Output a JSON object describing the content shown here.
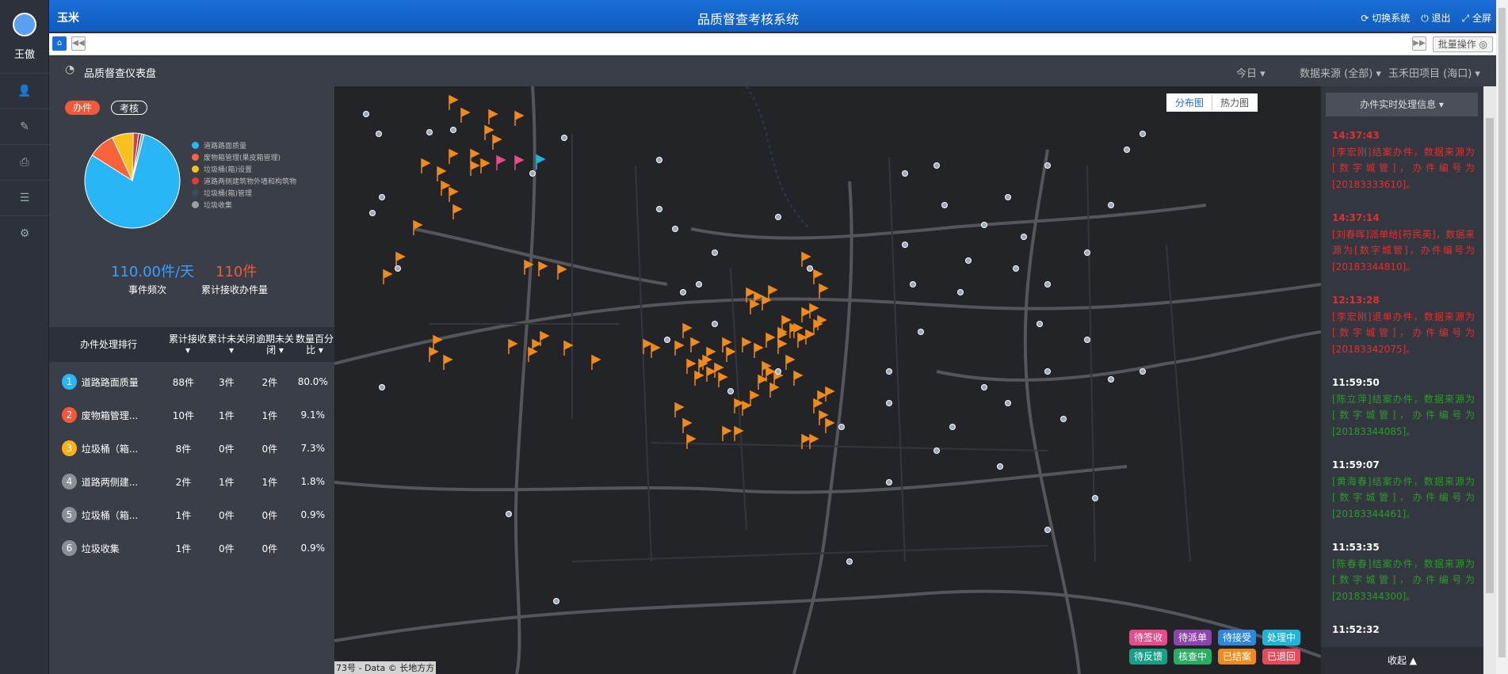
{
  "app": {
    "logo": "玉米",
    "title": "品质督查考核系统",
    "switch_label": "切换系统",
    "logout_label": "退出",
    "fullscreen_label": "全屏"
  },
  "tabbar": {
    "batch_label": "批量操作"
  },
  "user": {
    "name": "王傲"
  },
  "dashboard": {
    "title": "品质督查仪表盘",
    "filters": {
      "date": "今日",
      "source": "数据来源 (全部)",
      "project": "玉禾田项目 (海口)"
    }
  },
  "left": {
    "pills": [
      "办件",
      "考核"
    ],
    "pie_legend": [
      {
        "label": "道路路面质量",
        "color": "#29b6f6"
      },
      {
        "label": "废物箱管理(果皮箱管理)",
        "color": "#f7643c"
      },
      {
        "label": "垃圾桶(箱)设置",
        "color": "#f9c11d"
      },
      {
        "label": "道路两侧建筑物外墙和构筑物",
        "color": "#e53935"
      },
      {
        "label": "垃圾桶(箱)管理",
        "color": "#3f4a5c"
      },
      {
        "label": "垃圾收集",
        "color": "#9aa0a6"
      }
    ],
    "stat1_value": "110.00件/天",
    "stat1_label": "事件频次",
    "stat2_value": "110件",
    "stat2_label": "累计接收办件量",
    "rank_headers": [
      "办件处理排行",
      "累计接收",
      "累计未关闭",
      "逾期未关闭",
      "数量百分比"
    ],
    "rank_rows": [
      {
        "n": "1",
        "name": "道路路面质量",
        "recv": "88件",
        "open": "3件",
        "overdue": "2件",
        "pct": "80.0%",
        "color": "#29b6f6"
      },
      {
        "n": "2",
        "name": "废物箱管理...",
        "recv": "10件",
        "open": "1件",
        "overdue": "1件",
        "pct": "9.1%",
        "color": "#f05a3a"
      },
      {
        "n": "3",
        "name": "垃圾桶（箱...",
        "recv": "8件",
        "open": "0件",
        "overdue": "0件",
        "pct": "7.3%",
        "color": "#f9b21d"
      },
      {
        "n": "4",
        "name": "道路两侧建...",
        "recv": "2件",
        "open": "1件",
        "overdue": "1件",
        "pct": "1.8%",
        "color": "#8a8f98"
      },
      {
        "n": "5",
        "name": "垃圾桶（箱...",
        "recv": "1件",
        "open": "0件",
        "overdue": "0件",
        "pct": "0.9%",
        "color": "#8a8f98"
      },
      {
        "n": "6",
        "name": "垃圾收集",
        "recv": "1件",
        "open": "0件",
        "overdue": "0件",
        "pct": "0.9%",
        "color": "#8a8f98"
      }
    ]
  },
  "chart_data": {
    "type": "pie",
    "categories": [
      "道路路面质量",
      "废物箱管理",
      "垃圾桶(箱)设置",
      "道路两侧建筑物",
      "垃圾桶(箱)管理",
      "垃圾收集"
    ],
    "values": [
      88,
      10,
      8,
      2,
      1,
      1
    ]
  },
  "map": {
    "tabs": [
      "分布图",
      "热力图"
    ],
    "attribution": "73号 - Data © 长地方方",
    "legend": [
      {
        "label": "待签收",
        "color": "#e84a8a"
      },
      {
        "label": "待派单",
        "color": "#8e44ad"
      },
      {
        "label": "待接受",
        "color": "#2e86de"
      },
      {
        "label": "处理中",
        "color": "#1fb5d6"
      },
      {
        "label": "待反馈",
        "color": "#16a085"
      },
      {
        "label": "核查中",
        "color": "#27ae60"
      },
      {
        "label": "已结案",
        "color": "#f08a1a"
      },
      {
        "label": "已退回",
        "color": "#e84a5a"
      }
    ]
  },
  "right": {
    "head": "办件实时处理信息",
    "collapse": "收起",
    "feed": [
      {
        "time": "14:37:43",
        "time_color": "red",
        "text": "[李宏刚]结案办件，数据来源为[数字城管]，办件编号为[20183333610]。",
        "color": "red"
      },
      {
        "time": "14:37:14",
        "time_color": "red",
        "text": "[刘春晖]派单给[符民英]，数据来源为[数字城管]，办件编号为[20183344810]。",
        "color": "red"
      },
      {
        "time": "12:13:28",
        "time_color": "red",
        "text": "[李宏刚]退单办件，数据来源为[数字城管]，办件编号为[20183342075]。",
        "color": "red"
      },
      {
        "time": "11:59:50",
        "time_color": "white",
        "text": "[陈立萍]结案办件，数据来源为[数字城管]，办件编号为[20183344085]。",
        "color": "grn"
      },
      {
        "time": "11:59:07",
        "time_color": "white",
        "text": "[黄海春]结案办件，数据来源为[数字城管]，办件编号为[20183344461]。",
        "color": "grn"
      },
      {
        "time": "11:53:35",
        "time_color": "white",
        "text": "[陈春春]结案办件，数据来源为[数字城管]，办件编号为[20183344300]。",
        "color": "grn"
      },
      {
        "time": "11:52:32",
        "time_color": "white",
        "text": "",
        "color": "grn"
      }
    ]
  }
}
